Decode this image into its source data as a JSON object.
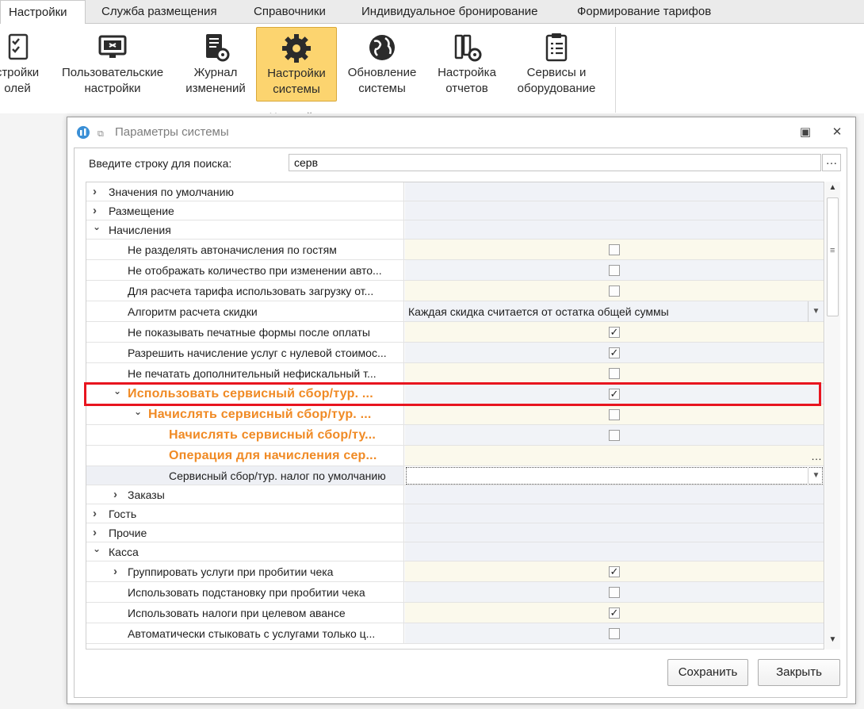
{
  "ribbon_tabs": [
    {
      "label": "Настройки",
      "active": true
    },
    {
      "label": "Служба размещения",
      "active": false
    },
    {
      "label": "Справочники",
      "active": false
    },
    {
      "label": "Индивидуальное бронирование",
      "active": false
    },
    {
      "label": "Формирование тарифов",
      "active": false
    }
  ],
  "ribbon_buttons": [
    {
      "line1": "стройки",
      "line2": "олей",
      "icon": "checklist-icon"
    },
    {
      "line1": "Пользовательские",
      "line2": "настройки",
      "icon": "monitor-settings-icon"
    },
    {
      "line1": "Журнал",
      "line2": "изменений",
      "icon": "journal-gear-icon"
    },
    {
      "line1": "Настройки",
      "line2": "системы",
      "icon": "gear-icon",
      "active": true
    },
    {
      "line1": "Обновление",
      "line2": "системы",
      "icon": "globe-icon"
    },
    {
      "line1": "Настройка",
      "line2": "отчетов",
      "icon": "binders-gear-icon"
    },
    {
      "line1": "Сервисы и",
      "line2": "оборудование",
      "icon": "clipboard-icon"
    }
  ],
  "ribbon_group_label": "Настройки",
  "dialog": {
    "title": "Параметры системы",
    "search_label": "Введите строку для поиска:",
    "search_value": "серв",
    "search_more": "…",
    "save_label": "Сохранить",
    "close_label": "Закрыть",
    "highlight_color": "#e8151f",
    "accent_orange": "#f08a24"
  },
  "rows": [
    {
      "name": "Значения по умолчанию",
      "level": 0,
      "chevron": "›",
      "type": "group"
    },
    {
      "name": "Размещение",
      "level": 0,
      "chevron": "›",
      "type": "group"
    },
    {
      "name": "Начисления",
      "level": 0,
      "chevron": "⌄",
      "type": "group"
    },
    {
      "name": "Не разделять автоначисления по гостям",
      "level": 1,
      "type": "check",
      "checked": false
    },
    {
      "name": "Не отображать количество при изменении авто...",
      "level": 1,
      "type": "check",
      "checked": false
    },
    {
      "name": "Для расчета тарифа использовать загрузку от...",
      "level": 1,
      "type": "check",
      "checked": false
    },
    {
      "name": "Алгоритм расчета скидки",
      "level": 1,
      "type": "dropdown",
      "value": "Каждая скидка считается от остатка общей суммы"
    },
    {
      "name": "Не показывать печатные формы после оплаты",
      "level": 1,
      "type": "check",
      "checked": true
    },
    {
      "name": "Разрешить начисление услуг с нулевой стоимос...",
      "level": 1,
      "type": "check",
      "checked": true
    },
    {
      "name": "Не печатать дополнительный нефискальный т...",
      "level": 1,
      "type": "check",
      "checked": false
    },
    {
      "name": "Использовать сервисный сбор/тур. ...",
      "level": 1,
      "chevron": "⌄",
      "type": "check",
      "checked": true,
      "highlight": true
    },
    {
      "name": "Начислять сервисный сбор/тур. ...",
      "level": 2,
      "chevron": "⌄",
      "type": "check",
      "checked": false,
      "highlight": true
    },
    {
      "name": "Начислять сервисный сбор/ту...",
      "level": 3,
      "type": "check",
      "checked": false,
      "highlight": true
    },
    {
      "name": "Операция для начисления сер...",
      "level": 3,
      "type": "ellipsis",
      "value": "…",
      "highlight": true
    },
    {
      "name": "Сервисный сбор/тур. налог по умолчанию",
      "level": 3,
      "type": "dropdown-focused",
      "value": ""
    },
    {
      "name": "Заказы",
      "level": 1,
      "chevron": "›",
      "type": "group"
    },
    {
      "name": "Гость",
      "level": 0,
      "chevron": "›",
      "type": "group"
    },
    {
      "name": "Прочие",
      "level": 0,
      "chevron": "›",
      "type": "group"
    },
    {
      "name": "Касса",
      "level": 0,
      "chevron": "⌄",
      "type": "group"
    },
    {
      "name": "Группировать услуги при пробитии чека",
      "level": 1,
      "chevron": "›",
      "type": "check",
      "checked": true
    },
    {
      "name": "Использовать подстановку при пробитии чека",
      "level": 1,
      "type": "check",
      "checked": false
    },
    {
      "name": "Использовать налоги при целевом авансе",
      "level": 1,
      "type": "check",
      "checked": true
    },
    {
      "name": "Автоматически стыковать с услугами только ц...",
      "level": 1,
      "type": "check",
      "checked": false
    }
  ]
}
